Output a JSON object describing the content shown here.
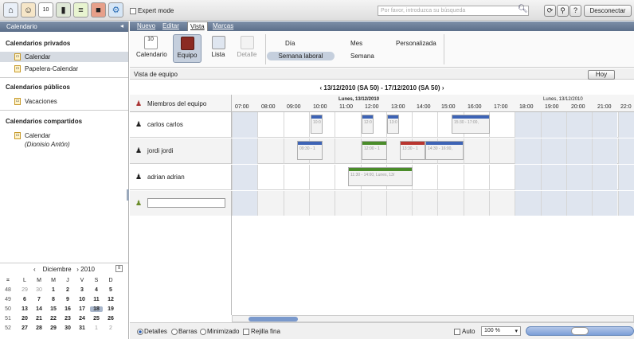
{
  "topbar": {
    "expert_mode": "Expert mode",
    "search_placeholder": "Por favor, introduzca su búsqueda",
    "logout": "Desconectar",
    "icons": [
      "home-icon",
      "contacts-icon",
      "calendar-app-icon",
      "chart-icon",
      "notes-icon",
      "briefcase-icon",
      "settings-icon"
    ]
  },
  "sidebar": {
    "title": "Calendario",
    "collapse": "◂",
    "private_title": "Calendarios privados",
    "private_items": [
      "Calendar",
      "Papelera-Calendar"
    ],
    "public_title": "Calendarios públicos",
    "public_items": [
      "Vacaciones"
    ],
    "shared_title": "Calendarios compartidos",
    "shared_items": [
      "Calendar"
    ],
    "shared_owner": "(Dionisio Antón)"
  },
  "mini_calendar": {
    "month": "Diciembre",
    "year": "2010",
    "prev": "‹",
    "next": "›",
    "weekday_headers": [
      "L",
      "M",
      "M",
      "J",
      "V",
      "S",
      "D"
    ],
    "weeks": [
      {
        "wk": "48",
        "days": [
          "29",
          "30",
          "1",
          "2",
          "3",
          "4",
          "5"
        ]
      },
      {
        "wk": "49",
        "days": [
          "6",
          "7",
          "8",
          "9",
          "10",
          "11",
          "12"
        ]
      },
      {
        "wk": "50",
        "days": [
          "13",
          "14",
          "15",
          "16",
          "17",
          "18",
          "19"
        ]
      },
      {
        "wk": "51",
        "days": [
          "20",
          "21",
          "22",
          "23",
          "24",
          "25",
          "26"
        ]
      },
      {
        "wk": "52",
        "days": [
          "27",
          "28",
          "29",
          "30",
          "31",
          "1",
          "2"
        ]
      }
    ],
    "today": "18"
  },
  "menubar": {
    "items": [
      "Nuevo",
      "Editar",
      "Vista",
      "Marcas"
    ],
    "active": "Vista"
  },
  "toolbar": {
    "views": [
      "Calendario",
      "Equipo",
      "Lista",
      "Detalle"
    ],
    "calendar_day": "10",
    "ranges": {
      "dia": "Día",
      "semana_laboral": "Semana laboral",
      "mes": "Mes",
      "semana": "Semana",
      "personalizada": "Personalizada"
    }
  },
  "view": {
    "title": "Vista de equipo",
    "today_button": "Hoy"
  },
  "datebar": {
    "prev": "‹",
    "next": "›",
    "label": "13/12/2010 (SA 50) - 17/12/2010 (SA 50)"
  },
  "grid": {
    "members_header": "Miembros del equipo",
    "day1": "Lunes, 13/12/2010",
    "day2": "Lunes, 13/12/2010",
    "hours": [
      "07:00",
      "08:00",
      "09:00",
      "10:00",
      "11:00",
      "12:00",
      "13:00",
      "14:00",
      "15:00",
      "16:00",
      "17:00",
      "18:00",
      "19:00",
      "20:00",
      "21:00",
      "22:0"
    ],
    "members": [
      "carlos carlos",
      "jordi jordi",
      "adrian adrian"
    ],
    "events": {
      "e1": "10:0",
      "e2": "12:0",
      "e3": "13:0",
      "e4": "15:30 - 17:00,",
      "e5": "09:30 - 1",
      "e6": "12:00 - 1",
      "e7": "13:30 - 1",
      "e8": "14:30 - 16:00,",
      "e9": "11:30 - 14:00, Lunes, 13/"
    },
    "event_colors": {
      "blue": "#3d63b5",
      "green": "#4a8c2a",
      "red": "#b8352f"
    }
  },
  "bottombar": {
    "opt_details": "Detalles",
    "opt_bars": "Barras",
    "opt_min": "Minimizado",
    "opt_fine": "Rejilla fina",
    "auto": "Auto",
    "zoom": "100 %"
  }
}
